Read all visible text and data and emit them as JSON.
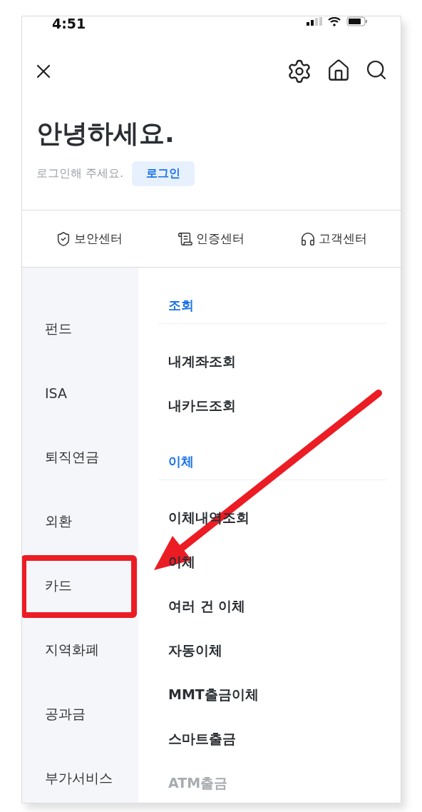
{
  "status_bar": {
    "time": "4:51"
  },
  "header": {
    "greeting": "안녕하세요.",
    "prompt": "로그인해 주세요.",
    "login_button": "로그인"
  },
  "shortcuts": [
    {
      "kind": "shield",
      "label": "보안센터"
    },
    {
      "kind": "certificate",
      "label": "인증센터"
    },
    {
      "kind": "headset",
      "label": "고객센터"
    }
  ],
  "sidebar": {
    "items": [
      {
        "label": "펀드",
        "highlighted": false
      },
      {
        "label": "ISA",
        "highlighted": false
      },
      {
        "label": "퇴직연금",
        "highlighted": false
      },
      {
        "label": "외환",
        "highlighted": false
      },
      {
        "label": "카드",
        "highlighted": true
      },
      {
        "label": "지역화폐",
        "highlighted": false
      },
      {
        "label": "공과금",
        "highlighted": false
      },
      {
        "label": "부가서비스",
        "highlighted": false
      }
    ]
  },
  "menu": [
    {
      "kind": "section",
      "label": "조회"
    },
    {
      "kind": "item",
      "label": "내계좌조회"
    },
    {
      "kind": "item",
      "label": "내카드조회"
    },
    {
      "kind": "section",
      "label": "이체"
    },
    {
      "kind": "item",
      "label": "이체내역조회"
    },
    {
      "kind": "item",
      "label": "이체"
    },
    {
      "kind": "item",
      "label": "여러 건 이체"
    },
    {
      "kind": "item",
      "label": "자동이체"
    },
    {
      "kind": "item",
      "label": "MMT출금이체"
    },
    {
      "kind": "item",
      "label": "스마트출금"
    },
    {
      "kind": "faded",
      "label": "ATM출금"
    }
  ],
  "annotations": [
    {
      "kind": "arrow"
    }
  ]
}
